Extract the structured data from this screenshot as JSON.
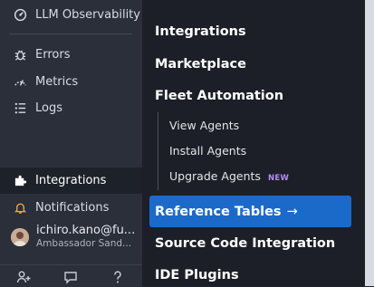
{
  "sidebar": {
    "items": [
      {
        "label": "LLM Observability",
        "icon": "gauge-icon"
      },
      {
        "label": "Errors",
        "icon": "bug-icon"
      },
      {
        "label": "Metrics",
        "icon": "pulse-icon"
      },
      {
        "label": "Logs",
        "icon": "logs-icon"
      },
      {
        "label": "Integrations",
        "icon": "puzzle-icon"
      },
      {
        "label": "Notifications",
        "icon": "bell-icon"
      }
    ],
    "user": {
      "name": "ichiro.kano@fu...",
      "org": "Ambassador Sand..."
    },
    "bottom_icons": [
      "add-user-icon",
      "chat-icon",
      "help-icon"
    ]
  },
  "flyout": {
    "integrations": "Integrations",
    "marketplace": "Marketplace",
    "fleet": "Fleet Automation",
    "sub_items": [
      {
        "label": "View Agents"
      },
      {
        "label": "Install Agents"
      },
      {
        "label": "Upgrade Agents",
        "badge": "NEW"
      }
    ],
    "reference_tables": "Reference Tables",
    "arrow": "→",
    "source_code": "Source Code Integration",
    "ide_plugins": "IDE Plugins"
  },
  "colors": {
    "accent": "#1b6ac9",
    "badge": "#b78bff",
    "notification_icon": "#f0a23b"
  }
}
